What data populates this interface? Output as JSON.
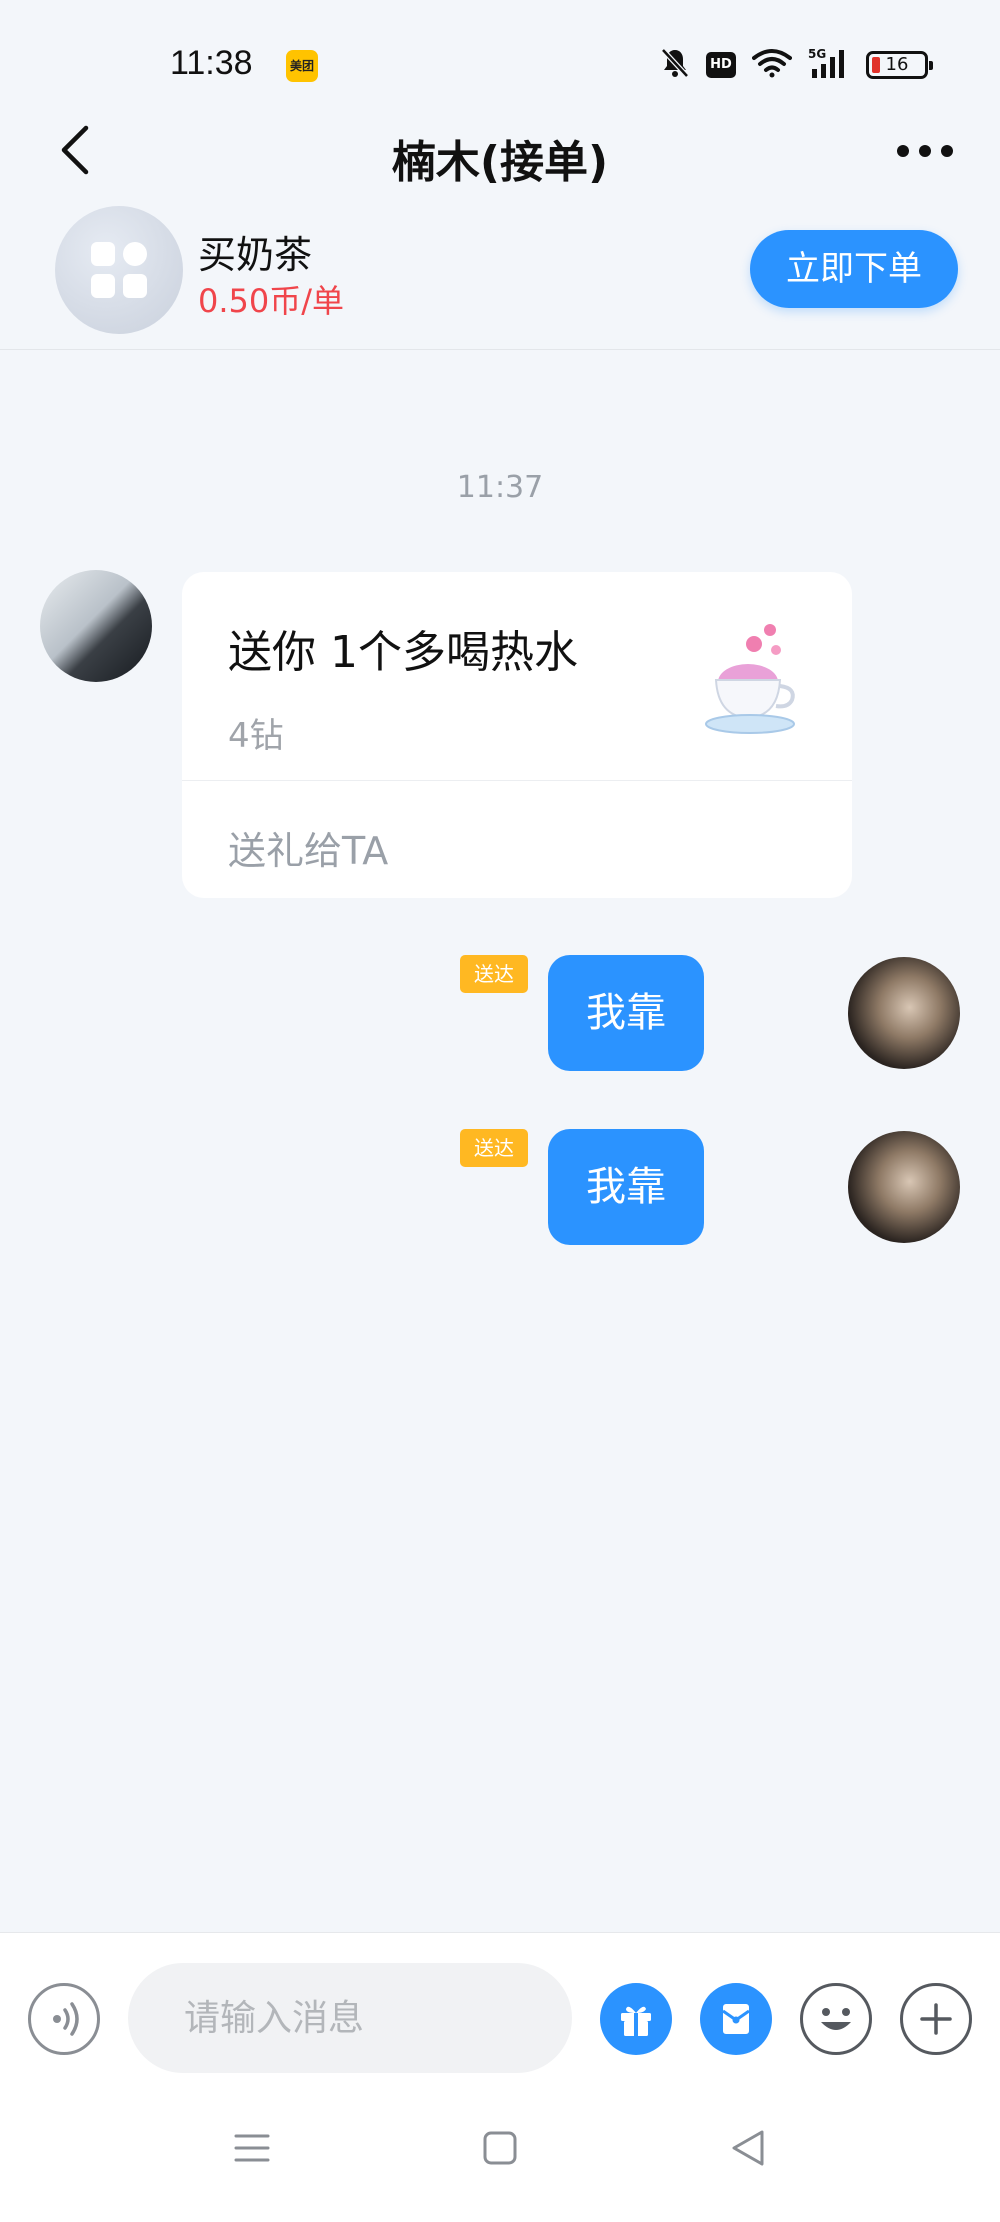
{
  "status_bar": {
    "time": "11:38",
    "app_badge": "美团",
    "network": "5G",
    "hd_label": "HD",
    "battery": "16"
  },
  "header": {
    "title": "楠木(接单)"
  },
  "service": {
    "name": "买奶茶",
    "price": "0.50币/单",
    "order_button": "立即下单"
  },
  "chat": {
    "timestamp": "11:37",
    "gift_card": {
      "title": "送你 1个多喝热水",
      "cost": "4钻",
      "action": "送礼给TA"
    },
    "messages": [
      {
        "status": "送达",
        "text": "我靠"
      },
      {
        "status": "送达",
        "text": "我靠"
      }
    ]
  },
  "input_bar": {
    "placeholder": "请输入消息"
  },
  "colors": {
    "accent": "#2b93ff",
    "price_red": "#f0454b",
    "badge_orange": "#ffb822",
    "background": "#f3f6fa"
  },
  "icons": [
    "back-arrow-icon",
    "more-icon",
    "grid-icon",
    "voice-icon",
    "gift-icon",
    "red-packet-icon",
    "emoji-icon",
    "plus-icon",
    "menu-icon",
    "home-icon",
    "back-triangle-icon"
  ]
}
